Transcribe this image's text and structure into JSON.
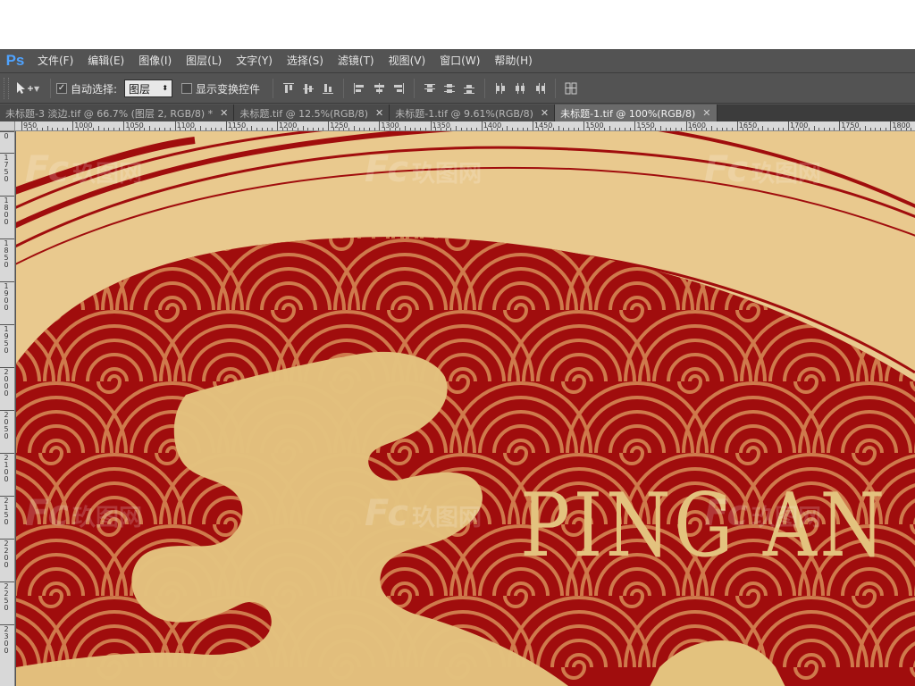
{
  "app": {
    "logo": "Ps",
    "menu": [
      "文件(F)",
      "编辑(E)",
      "图像(I)",
      "图层(L)",
      "文字(Y)",
      "选择(S)",
      "滤镜(T)",
      "视图(V)",
      "窗口(W)",
      "帮助(H)"
    ]
  },
  "options": {
    "auto_select_label": "自动选择:",
    "auto_select_checked": true,
    "layer_select_value": "图层",
    "show_transform_label": "显示变换控件",
    "show_transform_checked": false
  },
  "tabs": [
    {
      "label": "未标题-3 淡边.tif @ 66.7% (图层 2, RGB/8) *",
      "active": false
    },
    {
      "label": "未标题.tif @ 12.5%(RGB/8)",
      "active": false
    },
    {
      "label": "未标题-1.tif @ 9.61%(RGB/8)",
      "active": false
    },
    {
      "label": "未标题-1.tif @ 100%(RGB/8)",
      "active": true
    }
  ],
  "ruler": {
    "h_labels": [
      "950",
      "1000",
      "1050",
      "1100",
      "1150",
      "1200",
      "1250",
      "1300",
      "1350",
      "1400",
      "1450",
      "1500",
      "1550",
      "1600",
      "1650",
      "1700",
      "1750",
      "1800"
    ],
    "v_labels": [
      "0",
      "1\n7\n5\n0",
      "1\n8\n0\n0",
      "1\n8\n5\n0",
      "1\n9\n0\n0",
      "1\n9\n5\n0",
      "2\n0\n0\n0",
      "2\n0\n5\n0",
      "2\n1\n0\n0",
      "2\n1\n5\n0",
      "2\n2\n0\n0",
      "2\n2\n5\n0",
      "2\n3\n0\n0"
    ]
  },
  "artwork": {
    "text": "PING AN",
    "watermark_logo": "Fc",
    "watermark_cn": "玖图网",
    "colors": {
      "background": "#e9c98e",
      "red": "#a00d0d",
      "wave": "#cf7a4c",
      "gold": "#e3c27e"
    }
  }
}
